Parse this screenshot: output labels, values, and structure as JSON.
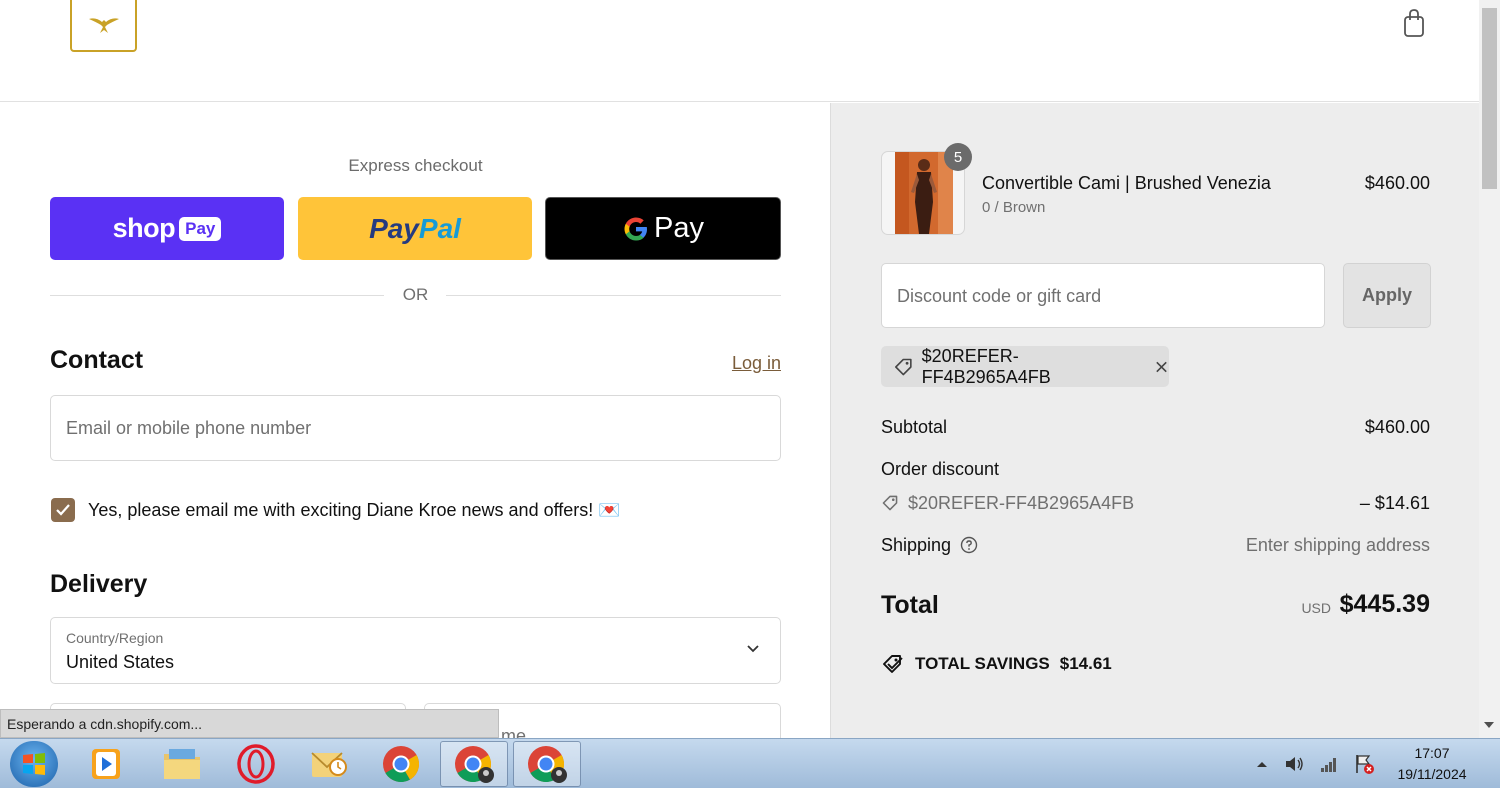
{
  "header": {
    "logo_icon": "eagle-logo",
    "cart_icon": "shopping-bag-icon"
  },
  "express": {
    "title": "Express checkout",
    "shop_pay_label": "shop",
    "shop_pay_badge": "Pay",
    "paypal_label_1": "Pay",
    "paypal_label_2": "Pal",
    "gpay_label": "Pay",
    "or_label": "OR"
  },
  "contact": {
    "title": "Contact",
    "login_label": "Log in",
    "email_placeholder": "Email or mobile phone number",
    "newsletter_label": "Yes, please email me with exciting Diane Kroe news and offers! 💌",
    "newsletter_checked": true
  },
  "delivery": {
    "title": "Delivery",
    "country_label": "Country/Region",
    "country_value": "United States",
    "last_name_partial": "me"
  },
  "order": {
    "item": {
      "quantity": "5",
      "name": "Convertible Cami | Brushed Venezia",
      "variant": "0 / Brown",
      "price": "$460.00"
    },
    "discount_placeholder": "Discount code or gift card",
    "apply_label": "Apply",
    "applied_code": "$20REFER-FF4B2965A4FB",
    "subtotal_label": "Subtotal",
    "subtotal_value": "$460.00",
    "order_discount_label": "Order discount",
    "discount_code": "$20REFER-FF4B2965A4FB",
    "discount_value": "– $14.61",
    "shipping_label": "Shipping",
    "shipping_value": "Enter shipping address",
    "total_label": "Total",
    "total_currency": "USD",
    "total_value": "$445.39",
    "savings_label": "TOTAL SAVINGS",
    "savings_value": "$14.61"
  },
  "browser": {
    "status_text": "Esperando a cdn.shopify.com..."
  },
  "taskbar": {
    "time": "17:07",
    "date": "19/11/2024"
  },
  "colors": {
    "shop_pay": "#5a31f4",
    "paypal": "#ffc439",
    "gpay": "#000000",
    "accent_brown": "#8a6c4e",
    "logo_gold": "#c9a227"
  }
}
